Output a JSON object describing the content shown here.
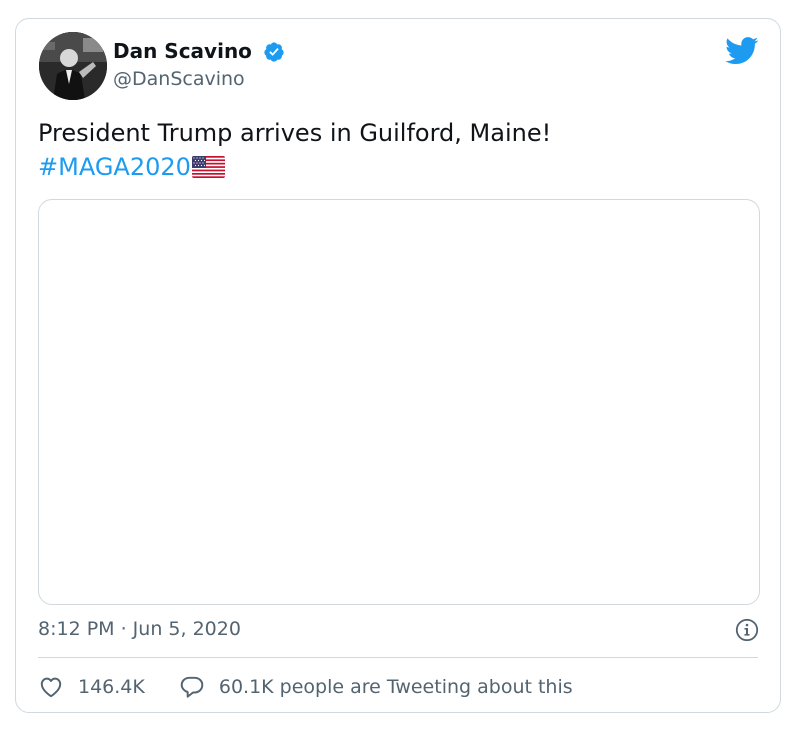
{
  "author": {
    "display_name": "Dan Scavino",
    "handle": "@DanScavino",
    "verified": true,
    "avatar_icon": "profile-photo"
  },
  "tweet": {
    "text": "President Trump arrives in Guilford, Maine!",
    "hashtag": "#MAGA2020",
    "emoji": "us-flag-emoji",
    "timestamp": "8:12 PM · Jun 5, 2020"
  },
  "stats": {
    "likes": "146.4K",
    "conversation": "60.1K people are Tweeting about this"
  },
  "icons": {
    "brand": "twitter-bird-icon",
    "verified": "verified-badge-icon",
    "info": "info-icon",
    "like": "heart-icon",
    "reply": "speech-bubble-icon"
  },
  "colors": {
    "accent": "#1d9bf0",
    "text": "#0f1419",
    "secondary": "#536471",
    "border": "#cfd9de"
  }
}
